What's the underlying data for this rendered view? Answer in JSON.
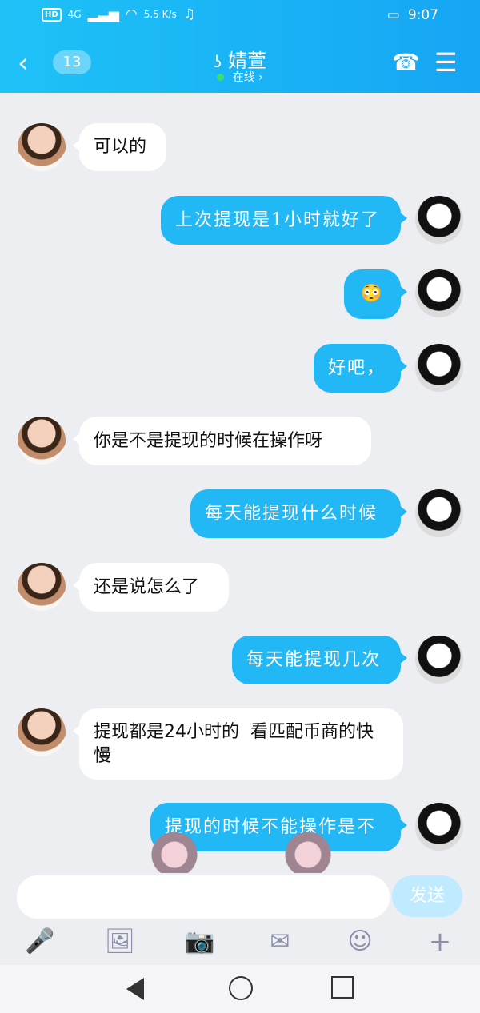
{
  "status": {
    "hd": "HD",
    "net": "4G",
    "speed": "5.5 K/s",
    "time": "9:07"
  },
  "header": {
    "badge": "13",
    "name": "婧萱",
    "online": "在线",
    "chev": "›"
  },
  "messages": [
    {
      "side": "left",
      "text": "可以的"
    },
    {
      "side": "right",
      "text": "上次提现是1小时就好了"
    },
    {
      "side": "right",
      "text": "😳"
    },
    {
      "side": "right",
      "text": "好吧，"
    },
    {
      "side": "left",
      "text": "你是不是提现的时候在操作呀"
    },
    {
      "side": "right",
      "text": "每天能提现什么时候"
    },
    {
      "side": "left",
      "text": "还是说怎么了"
    },
    {
      "side": "right",
      "text": "每天能提现几次"
    },
    {
      "side": "left",
      "text": "提现都是24小时的  看匹配币商的快慢"
    },
    {
      "side": "right",
      "text": "提现的时候不能操作是不"
    }
  ],
  "input": {
    "send": "发送"
  },
  "toolbar": {
    "mic": "🎤",
    "image": "🖼",
    "camera": "📷",
    "redpacket": "✉",
    "emoji": "☺",
    "plus": "+"
  }
}
